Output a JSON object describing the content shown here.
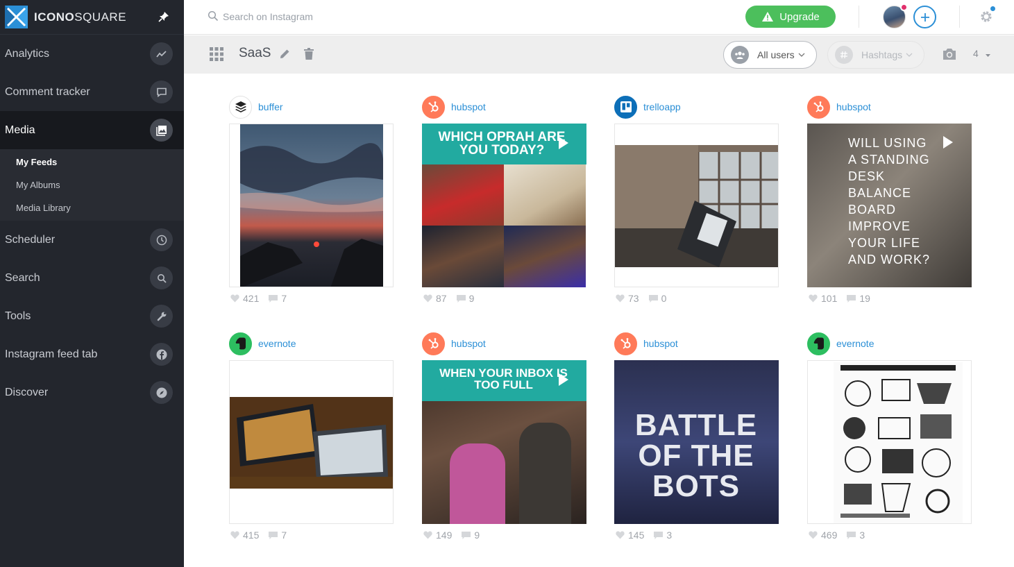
{
  "app": {
    "name_prefix": "ICONO",
    "name_suffix": "SQUARE"
  },
  "sidebar": {
    "items": [
      {
        "label": "Analytics",
        "icon": "trend-icon"
      },
      {
        "label": "Comment tracker",
        "icon": "comment-icon"
      },
      {
        "label": "Media",
        "icon": "image-icon",
        "active": true
      },
      {
        "label": "Scheduler",
        "icon": "clock-icon"
      },
      {
        "label": "Search",
        "icon": "search-icon"
      },
      {
        "label": "Tools",
        "icon": "wrench-icon"
      },
      {
        "label": "Instagram feed tab",
        "icon": "facebook-icon"
      },
      {
        "label": "Discover",
        "icon": "compass-icon"
      }
    ],
    "media_submenu": [
      {
        "label": "My Feeds",
        "active": true
      },
      {
        "label": "My Albums"
      },
      {
        "label": "Media Library"
      }
    ]
  },
  "topbar": {
    "search_placeholder": "Search on Instagram",
    "upgrade_label": "Upgrade"
  },
  "toolbar": {
    "feed_title": "SaaS",
    "users_filter": "All users",
    "hashtags_filter": "Hashtags",
    "columns": "4"
  },
  "colors": {
    "accent": "#2b8fd6",
    "upgrade": "#4cbf5c",
    "sidebar": "#23262d",
    "hubspot": "#ff7a59"
  },
  "posts": [
    {
      "account": "buffer",
      "likes": "421",
      "comments": "7"
    },
    {
      "account": "hubspot",
      "likes": "87",
      "comments": "9",
      "caption": "WHICH OPRAH ARE YOU TODAY?"
    },
    {
      "account": "trelloapp",
      "likes": "73",
      "comments": "0"
    },
    {
      "account": "hubspot",
      "likes": "101",
      "comments": "19",
      "caption": "WILL USING A STANDING DESK BALANCE BOARD IMPROVE YOUR LIFE AND WORK?"
    },
    {
      "account": "evernote",
      "likes": "415",
      "comments": "7"
    },
    {
      "account": "hubspot",
      "likes": "149",
      "comments": "9",
      "caption": "WHEN YOUR INBOX IS TOO FULL"
    },
    {
      "account": "hubspot",
      "likes": "145",
      "comments": "3",
      "caption": "BATTLE OF THE BOTS"
    },
    {
      "account": "evernote",
      "likes": "469",
      "comments": "3"
    }
  ]
}
